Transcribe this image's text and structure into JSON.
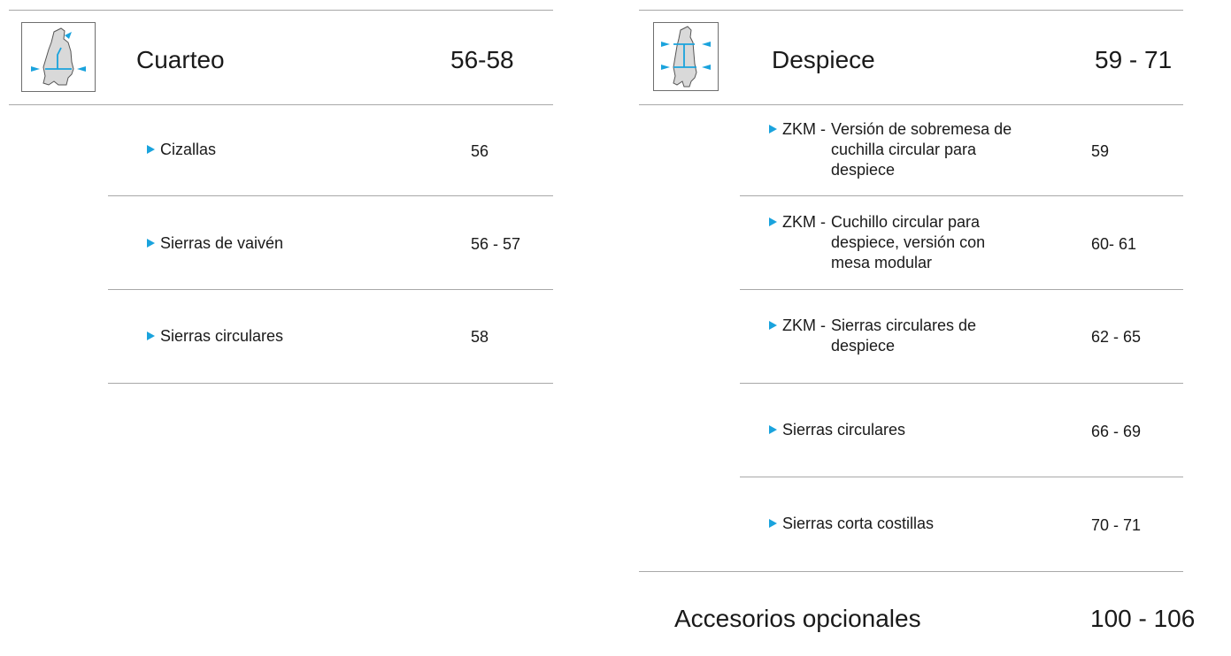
{
  "left": {
    "icon": "carcass-quartering-icon",
    "title": "Cuarteo",
    "pages": "56-58",
    "items": [
      {
        "label": "Cizallas",
        "pages": "56"
      },
      {
        "label": "Sierras de vaivén",
        "pages": "56 - 57"
      },
      {
        "label": "Sierras circulares",
        "pages": "58"
      }
    ]
  },
  "right": {
    "icon": "carcass-cutting-icon",
    "title": "Despiece",
    "pages": "59 - 71",
    "zkm_items": [
      {
        "prefix": "ZKM -",
        "desc": "Versión de sobremesa de cuchilla circular para despiece",
        "pages": "59"
      },
      {
        "prefix": "ZKM -",
        "desc": "Cuchillo circular para despiece, versión con mesa modular",
        "pages": "60- 61"
      },
      {
        "prefix": "ZKM -",
        "desc": "Sierras circulares de despiece",
        "pages": "62 - 65"
      }
    ],
    "items": [
      {
        "label": "Sierras circulares",
        "pages": "66 - 69"
      },
      {
        "label": "Sierras corta costillas",
        "pages": "70 - 71"
      }
    ]
  },
  "accessories": {
    "label": "Accesorios opcionales",
    "pages": "100 - 106"
  },
  "colors": {
    "accent": "#1aa3dd",
    "rule": "#a8a8a8",
    "text": "#1a1a1a"
  }
}
